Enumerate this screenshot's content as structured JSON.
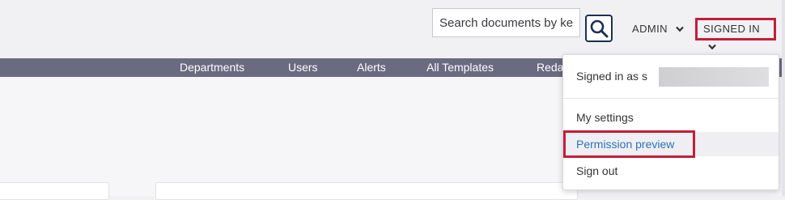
{
  "header": {
    "search": {
      "placeholder": "Search documents by keyword"
    },
    "admin_menu": {
      "label": "ADMIN"
    },
    "signed_menu": {
      "label": "SIGNED IN"
    }
  },
  "nav": {
    "items": [
      {
        "label": "Departments"
      },
      {
        "label": "Users"
      },
      {
        "label": "Alerts"
      },
      {
        "label": "All Templates"
      },
      {
        "label": "Redac"
      }
    ]
  },
  "dropdown": {
    "signed_in_as": "Signed in as s",
    "items": [
      {
        "label": "My settings"
      },
      {
        "label": "Permission preview"
      },
      {
        "label": "Sign out"
      }
    ]
  },
  "colors": {
    "nav_bg": "#6a6a80",
    "highlight_outline": "#c21f3a",
    "link": "#2a74b5",
    "search_button_border": "#1f2e57"
  }
}
